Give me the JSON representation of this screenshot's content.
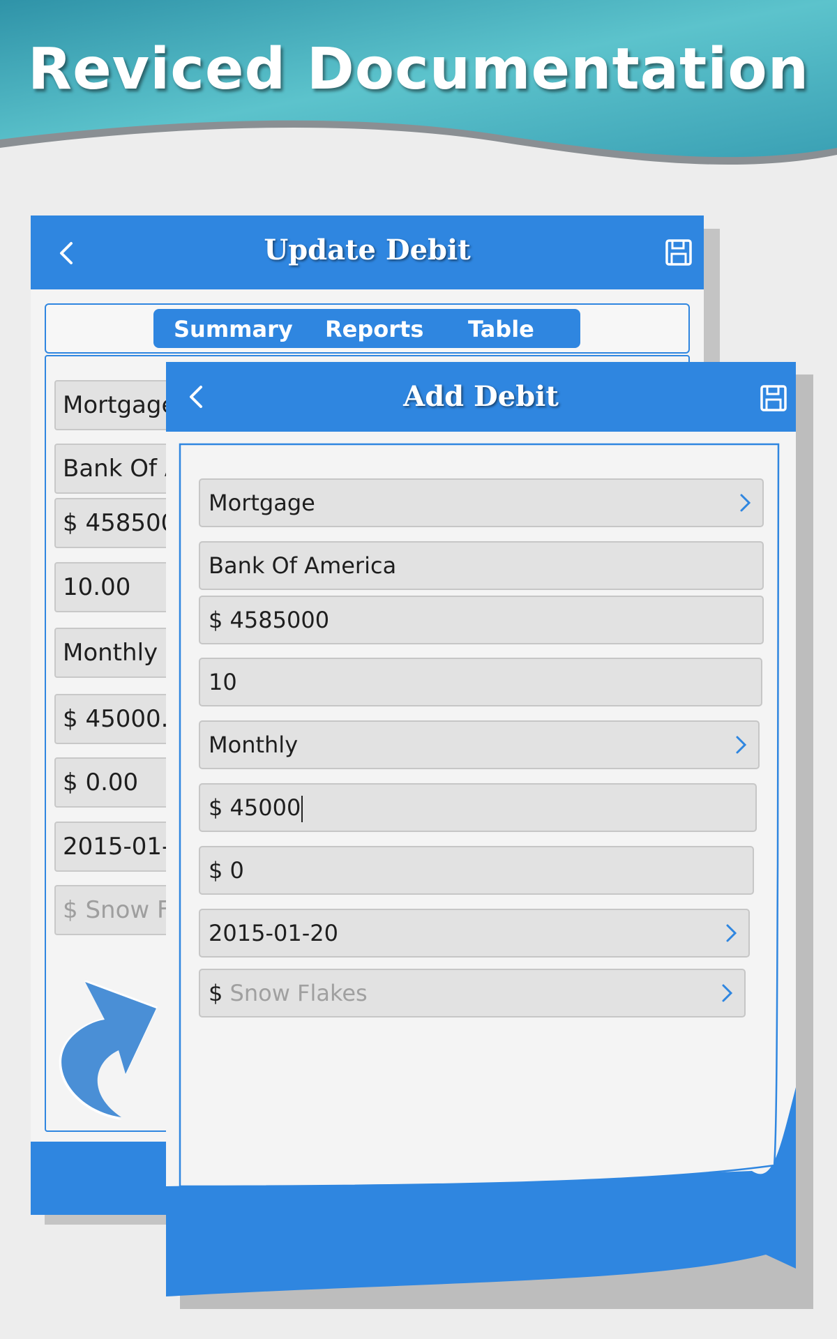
{
  "banner": {
    "title": "Reviced Documentation"
  },
  "colors": {
    "accent": "#2f86e0",
    "banner_teal": "#4fb6c6"
  },
  "back_screen": {
    "title": "Update Debit",
    "back_icon": "chevron-left-icon",
    "save_icon": "floppy-save-icon",
    "tabs": [
      {
        "label": "Summary"
      },
      {
        "label": "Reports"
      },
      {
        "label": "Table"
      }
    ],
    "fields": [
      {
        "value": "Mortgage"
      },
      {
        "value": "Bank Of A"
      },
      {
        "value": "$ 458500"
      },
      {
        "value": "10.00"
      },
      {
        "value": "Monthly"
      },
      {
        "value": "$ 45000.0"
      },
      {
        "value": "$  0.00"
      },
      {
        "value": "2015-01-"
      },
      {
        "value": "$  Snow F"
      }
    ]
  },
  "front_screen": {
    "title": "Add Debit",
    "back_icon": "chevron-left-icon",
    "save_icon": "floppy-save-icon",
    "fields": [
      {
        "value": "Mortgage",
        "icon": "chevron-right-icon"
      },
      {
        "value": "Bank Of America"
      },
      {
        "value": "$ 4585000"
      },
      {
        "value": "10"
      },
      {
        "value": "Monthly",
        "icon": "chevron-right-icon"
      },
      {
        "value": "$ 45000"
      },
      {
        "value": "$ 0"
      },
      {
        "value": "2015-01-20",
        "icon": "chevron-right-icon"
      },
      {
        "placeholder": "Snow Flakes",
        "prefix": "$",
        "icon": "chevron-right-icon"
      }
    ]
  }
}
